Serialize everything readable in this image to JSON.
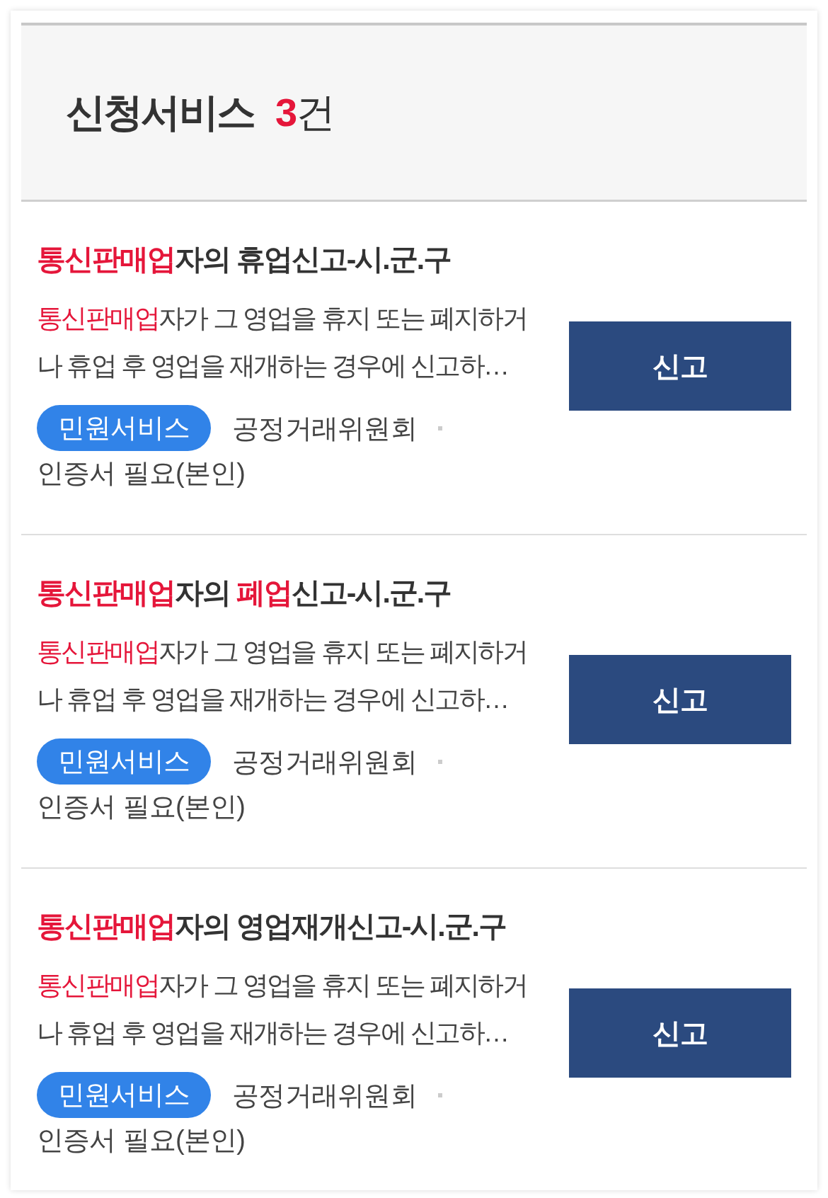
{
  "header": {
    "title": "신청서비스",
    "count": "3",
    "unit": "건"
  },
  "services": [
    {
      "title": [
        {
          "text": "통신판매업",
          "highlight": true
        },
        {
          "text": "자의 휴업신고-시.군.구",
          "highlight": false
        }
      ],
      "description": [
        {
          "text": "통신판매업",
          "highlight": true
        },
        {
          "text": "자가 그 영업을 휴지 또는 폐지하거나 휴업 후 영업을 재개하는 경우에 신고하…",
          "highlight": false
        }
      ],
      "tag": "민원서비스",
      "agency": "공정거래위원회",
      "requirement": "인증서 필요(본인)",
      "button": "신고"
    },
    {
      "title": [
        {
          "text": "통신판매업",
          "highlight": true
        },
        {
          "text": "자의 ",
          "highlight": false
        },
        {
          "text": "폐업",
          "highlight": true
        },
        {
          "text": "신고-시.군.구",
          "highlight": false
        }
      ],
      "description": [
        {
          "text": "통신판매업",
          "highlight": true
        },
        {
          "text": "자가 그 영업을 휴지 또는 폐지하거나 휴업 후 영업을 재개하는 경우에 신고하…",
          "highlight": false
        }
      ],
      "tag": "민원서비스",
      "agency": "공정거래위원회",
      "requirement": "인증서 필요(본인)",
      "button": "신고"
    },
    {
      "title": [
        {
          "text": "통신판매업",
          "highlight": true
        },
        {
          "text": "자의 영업재개신고-시.군.구",
          "highlight": false
        }
      ],
      "description": [
        {
          "text": "통신판매업",
          "highlight": true
        },
        {
          "text": "자가 그 영업을 휴지 또는 폐지하거나 휴업 후 영업을 재개하는 경우에 신고하…",
          "highlight": false
        }
      ],
      "tag": "민원서비스",
      "agency": "공정거래위원회",
      "requirement": "인증서 필요(본인)",
      "button": "신고"
    }
  ]
}
